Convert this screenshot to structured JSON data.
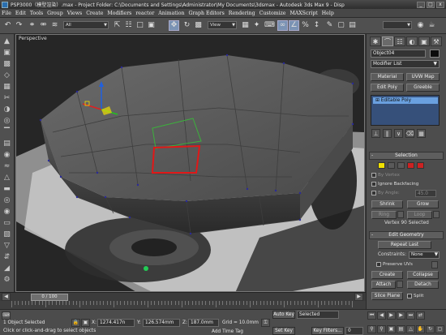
{
  "window": {
    "title": "PSP3000（模型渲染）.max   - Project Folder: C:\\Documents and Settings\\Administrator\\My Documents\\3dsmax   - Autodesk 3ds Max 9   - Disp",
    "minimize": "_",
    "maximize": "□",
    "close": "x"
  },
  "menu": [
    "File",
    "Edit",
    "Tools",
    "Group",
    "Views",
    "Create",
    "Modifiers",
    "reactor",
    "Animation",
    "Graph Editors",
    "Rendering",
    "Customize",
    "MAXScript",
    "Help"
  ],
  "toolbar": {
    "selection_filter": "All",
    "reference_coord": "View",
    "named_selection": ""
  },
  "viewport": {
    "label": "Perspective"
  },
  "command_panel": {
    "tabs": [
      "✱",
      "⌒",
      "☷",
      "◐",
      "▣",
      "⚒"
    ],
    "object_name": "Object04",
    "modifier_list": "Modifier List",
    "buttons": [
      "Material",
      "UVW Map",
      "Edit Poly",
      "Greeble"
    ],
    "stack_item": "Editable Poly",
    "selection": {
      "title": "Selection",
      "by_vertex": "By Vertex",
      "ignore_backfacing": "Ignore Backfacing",
      "by_angle": "By Angle:",
      "by_angle_value": "45.0",
      "shrink": "Shrink",
      "grow": "Grow",
      "ring": "Ring",
      "loop": "Loop",
      "status": "Vertex 90 Selected"
    },
    "edit_geometry": {
      "title": "Edit Geometry",
      "repeat_last": "Repeat Last",
      "constraints_label": "Constraints:",
      "constraints_value": "None",
      "preserve_uvs": "Preserve UVs",
      "create": "Create",
      "collapse": "Collapse",
      "attach": "Attach",
      "detach": "Detach",
      "slice_plane": "Slice Plane",
      "split": "Split"
    }
  },
  "timeline": {
    "frame": "0 / 100",
    "ticks": [
      "0",
      "10",
      "20",
      "30",
      "40",
      "50",
      "60",
      "70",
      "80",
      "90",
      "100"
    ]
  },
  "status": {
    "selection": "1 Object Selected",
    "prompt": "Click or click-and-drag to select objects",
    "x_label": "X:",
    "x_value": "1274.417n",
    "y_label": "Y:",
    "y_value": "126.574mm",
    "z_label": "Z:",
    "z_value": "187.0mm",
    "grid": "Grid = 10.0mm",
    "add_time_tag": "Add Time Tag",
    "auto_key": "Auto Key",
    "set_key": "Set Key",
    "key_mode": "Selected",
    "key_filters": "Key Filters...",
    "frame_field": "0"
  },
  "colors": {
    "stack_highlight": "#6aa0df",
    "auto_key": "#9e9e9e",
    "selection_red": "#e01818",
    "vertex_yellow": "#f0e000"
  }
}
